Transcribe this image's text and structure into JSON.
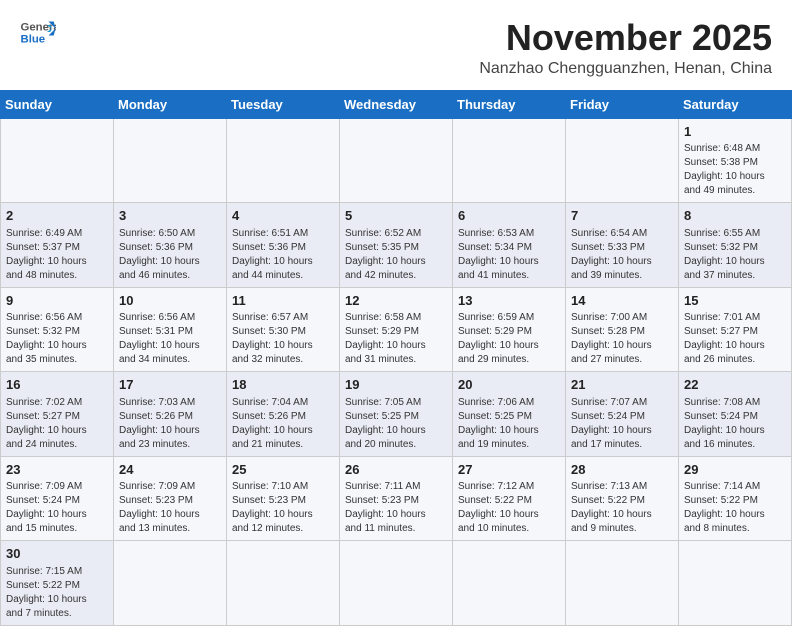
{
  "header": {
    "logo_general": "General",
    "logo_blue": "Blue",
    "title": "November 2025",
    "subtitle": "Nanzhao Chengguanzhen, Henan, China"
  },
  "weekdays": [
    "Sunday",
    "Monday",
    "Tuesday",
    "Wednesday",
    "Thursday",
    "Friday",
    "Saturday"
  ],
  "weeks": [
    [
      {
        "day": "",
        "info": ""
      },
      {
        "day": "",
        "info": ""
      },
      {
        "day": "",
        "info": ""
      },
      {
        "day": "",
        "info": ""
      },
      {
        "day": "",
        "info": ""
      },
      {
        "day": "",
        "info": ""
      },
      {
        "day": "1",
        "info": "Sunrise: 6:48 AM\nSunset: 5:38 PM\nDaylight: 10 hours\nand 49 minutes."
      }
    ],
    [
      {
        "day": "2",
        "info": "Sunrise: 6:49 AM\nSunset: 5:37 PM\nDaylight: 10 hours\nand 48 minutes."
      },
      {
        "day": "3",
        "info": "Sunrise: 6:50 AM\nSunset: 5:36 PM\nDaylight: 10 hours\nand 46 minutes."
      },
      {
        "day": "4",
        "info": "Sunrise: 6:51 AM\nSunset: 5:36 PM\nDaylight: 10 hours\nand 44 minutes."
      },
      {
        "day": "5",
        "info": "Sunrise: 6:52 AM\nSunset: 5:35 PM\nDaylight: 10 hours\nand 42 minutes."
      },
      {
        "day": "6",
        "info": "Sunrise: 6:53 AM\nSunset: 5:34 PM\nDaylight: 10 hours\nand 41 minutes."
      },
      {
        "day": "7",
        "info": "Sunrise: 6:54 AM\nSunset: 5:33 PM\nDaylight: 10 hours\nand 39 minutes."
      },
      {
        "day": "8",
        "info": "Sunrise: 6:55 AM\nSunset: 5:32 PM\nDaylight: 10 hours\nand 37 minutes."
      }
    ],
    [
      {
        "day": "9",
        "info": "Sunrise: 6:56 AM\nSunset: 5:32 PM\nDaylight: 10 hours\nand 35 minutes."
      },
      {
        "day": "10",
        "info": "Sunrise: 6:56 AM\nSunset: 5:31 PM\nDaylight: 10 hours\nand 34 minutes."
      },
      {
        "day": "11",
        "info": "Sunrise: 6:57 AM\nSunset: 5:30 PM\nDaylight: 10 hours\nand 32 minutes."
      },
      {
        "day": "12",
        "info": "Sunrise: 6:58 AM\nSunset: 5:29 PM\nDaylight: 10 hours\nand 31 minutes."
      },
      {
        "day": "13",
        "info": "Sunrise: 6:59 AM\nSunset: 5:29 PM\nDaylight: 10 hours\nand 29 minutes."
      },
      {
        "day": "14",
        "info": "Sunrise: 7:00 AM\nSunset: 5:28 PM\nDaylight: 10 hours\nand 27 minutes."
      },
      {
        "day": "15",
        "info": "Sunrise: 7:01 AM\nSunset: 5:27 PM\nDaylight: 10 hours\nand 26 minutes."
      }
    ],
    [
      {
        "day": "16",
        "info": "Sunrise: 7:02 AM\nSunset: 5:27 PM\nDaylight: 10 hours\nand 24 minutes."
      },
      {
        "day": "17",
        "info": "Sunrise: 7:03 AM\nSunset: 5:26 PM\nDaylight: 10 hours\nand 23 minutes."
      },
      {
        "day": "18",
        "info": "Sunrise: 7:04 AM\nSunset: 5:26 PM\nDaylight: 10 hours\nand 21 minutes."
      },
      {
        "day": "19",
        "info": "Sunrise: 7:05 AM\nSunset: 5:25 PM\nDaylight: 10 hours\nand 20 minutes."
      },
      {
        "day": "20",
        "info": "Sunrise: 7:06 AM\nSunset: 5:25 PM\nDaylight: 10 hours\nand 19 minutes."
      },
      {
        "day": "21",
        "info": "Sunrise: 7:07 AM\nSunset: 5:24 PM\nDaylight: 10 hours\nand 17 minutes."
      },
      {
        "day": "22",
        "info": "Sunrise: 7:08 AM\nSunset: 5:24 PM\nDaylight: 10 hours\nand 16 minutes."
      }
    ],
    [
      {
        "day": "23",
        "info": "Sunrise: 7:09 AM\nSunset: 5:24 PM\nDaylight: 10 hours\nand 15 minutes."
      },
      {
        "day": "24",
        "info": "Sunrise: 7:09 AM\nSunset: 5:23 PM\nDaylight: 10 hours\nand 13 minutes."
      },
      {
        "day": "25",
        "info": "Sunrise: 7:10 AM\nSunset: 5:23 PM\nDaylight: 10 hours\nand 12 minutes."
      },
      {
        "day": "26",
        "info": "Sunrise: 7:11 AM\nSunset: 5:23 PM\nDaylight: 10 hours\nand 11 minutes."
      },
      {
        "day": "27",
        "info": "Sunrise: 7:12 AM\nSunset: 5:22 PM\nDaylight: 10 hours\nand 10 minutes."
      },
      {
        "day": "28",
        "info": "Sunrise: 7:13 AM\nSunset: 5:22 PM\nDaylight: 10 hours\nand 9 minutes."
      },
      {
        "day": "29",
        "info": "Sunrise: 7:14 AM\nSunset: 5:22 PM\nDaylight: 10 hours\nand 8 minutes."
      }
    ],
    [
      {
        "day": "30",
        "info": "Sunrise: 7:15 AM\nSunset: 5:22 PM\nDaylight: 10 hours\nand 7 minutes."
      },
      {
        "day": "",
        "info": ""
      },
      {
        "day": "",
        "info": ""
      },
      {
        "day": "",
        "info": ""
      },
      {
        "day": "",
        "info": ""
      },
      {
        "day": "",
        "info": ""
      },
      {
        "day": "",
        "info": ""
      }
    ]
  ]
}
